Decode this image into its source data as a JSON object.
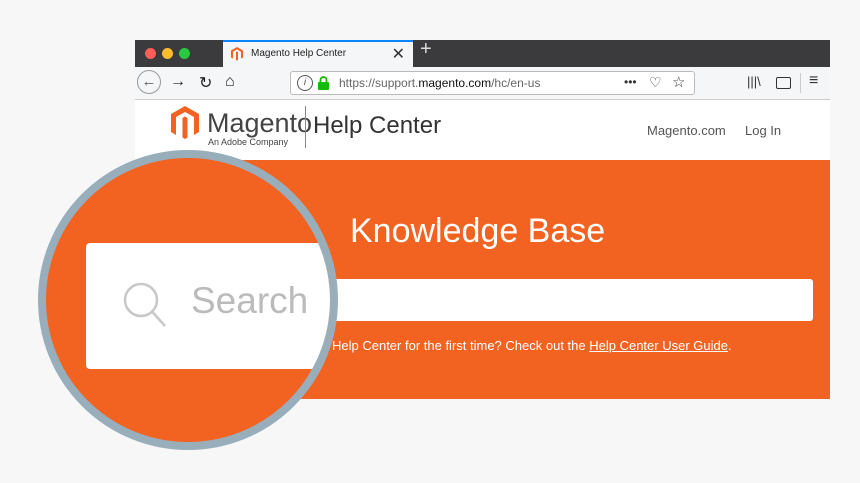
{
  "browser": {
    "tab_title": "Magento Help Center",
    "tab_close": "✕",
    "new_tab": "+",
    "url_prefix": "https://support.",
    "url_domain": "magento.com",
    "url_path": "/hc/en-us",
    "page_actions": "•••"
  },
  "site": {
    "logo_name": "Magento",
    "logo_tagline": "An Adobe Company",
    "section_title": "Help Center",
    "nav_links": [
      "Magento.com",
      "Log In"
    ],
    "accent_color": "#f26322"
  },
  "hero": {
    "title": "Knowledge Base",
    "search_placeholder": "Search",
    "hint_text": "Help Center for the first time? Check out the ",
    "hint_link": "Help Center User Guide",
    "hint_end": "."
  }
}
